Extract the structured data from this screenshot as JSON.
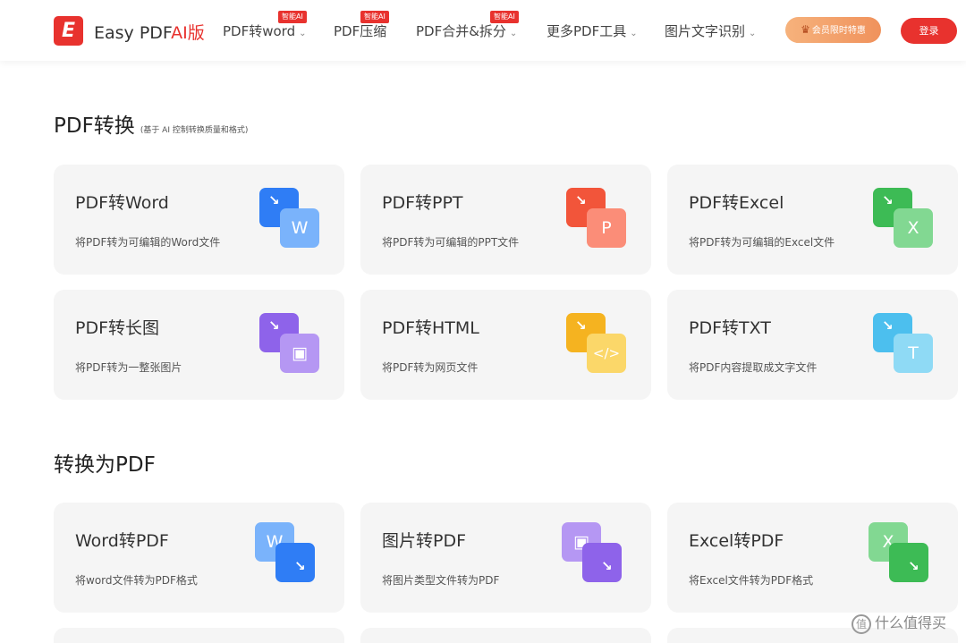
{
  "header": {
    "logo_letter": "E",
    "brand_prefix": "Easy PDF",
    "brand_ai": "AI版",
    "nav": [
      {
        "label": "PDF转word",
        "badge": "智能AI",
        "has_dropdown": true
      },
      {
        "label": "PDF压缩",
        "badge": "智能AI",
        "has_dropdown": false
      },
      {
        "label": "PDF合并&拆分",
        "badge": "智能AI",
        "has_dropdown": true
      },
      {
        "label": "更多PDF工具",
        "badge": "",
        "has_dropdown": true
      },
      {
        "label": "图片文字识别",
        "badge": "",
        "has_dropdown": true
      }
    ],
    "vip_label": "会员限时特惠",
    "login_label": "登录"
  },
  "sections": [
    {
      "title": "PDF转换",
      "subtitle": "(基于 AI 控制转换质量和格式)",
      "cards": [
        {
          "title": "PDF转Word",
          "desc": "将PDF转为可编辑的Word文件",
          "icon": "pdf-to-word-icon",
          "glyph": "W",
          "color": "#2f7df5",
          "light": "#7ab3fb"
        },
        {
          "title": "PDF转PPT",
          "desc": "将PDF转为可编辑的PPT文件",
          "icon": "pdf-to-ppt-icon",
          "glyph": "P",
          "color": "#f2553a",
          "light": "#fb8d78"
        },
        {
          "title": "PDF转Excel",
          "desc": "将PDF转为可编辑的Excel文件",
          "icon": "pdf-to-excel-icon",
          "glyph": "X",
          "color": "#3dbb55",
          "light": "#82d892"
        },
        {
          "title": "PDF转长图",
          "desc": "将PDF转为一整张图片",
          "icon": "pdf-to-image-icon",
          "glyph": "▣",
          "color": "#8e63ea",
          "light": "#b597f3"
        },
        {
          "title": "PDF转HTML",
          "desc": "将PDF转为网页文件",
          "icon": "pdf-to-html-icon",
          "glyph": "</>",
          "color": "#f5b320",
          "light": "#fbd769"
        },
        {
          "title": "PDF转TXT",
          "desc": "将PDF内容提取成文字文件",
          "icon": "pdf-to-txt-icon",
          "glyph": "T",
          "color": "#4cbfee",
          "light": "#8fdaf5"
        }
      ]
    },
    {
      "title": "转换为PDF",
      "subtitle": "",
      "cards": [
        {
          "title": "Word转PDF",
          "desc": "将word文件转为PDF格式",
          "icon": "word-to-pdf-icon",
          "glyph": "W",
          "color": "#2f7df5",
          "light": "#7ab3fb"
        },
        {
          "title": "图片转PDF",
          "desc": "将图片类型文件转为PDF",
          "icon": "image-to-pdf-icon",
          "glyph": "▣",
          "color": "#8e63ea",
          "light": "#b597f3"
        },
        {
          "title": "Excel转PDF",
          "desc": "将Excel文件转为PDF格式",
          "icon": "excel-to-pdf-icon",
          "glyph": "X",
          "color": "#3dbb55",
          "light": "#82d892"
        }
      ]
    }
  ],
  "watermark": "什么值得买"
}
